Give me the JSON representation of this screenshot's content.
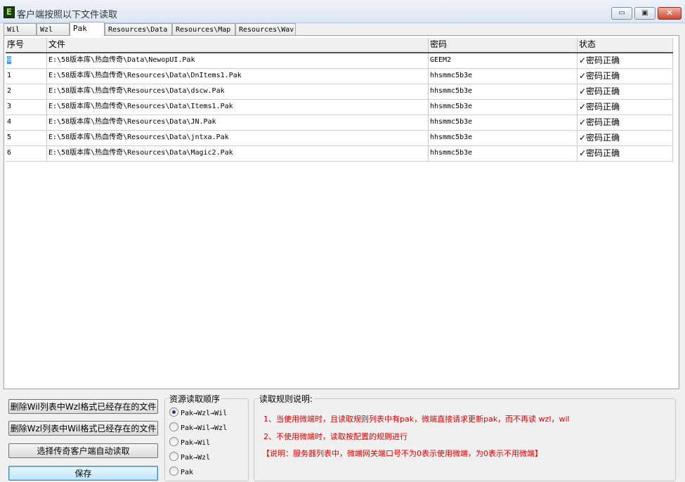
{
  "window": {
    "title": "客户端按照以下文件读取",
    "app_icon": "E",
    "controls": {
      "minimize": "▭",
      "maximize": "▣",
      "close": "✕"
    }
  },
  "tabs": [
    {
      "label": "Wil",
      "active": false
    },
    {
      "label": "Wzl",
      "active": false
    },
    {
      "label": "Pak",
      "active": true
    },
    {
      "label": "Resources\\Data",
      "active": false
    },
    {
      "label": "Resources\\Map",
      "active": false
    },
    {
      "label": "Resources\\Wav",
      "active": false
    }
  ],
  "table": {
    "columns": [
      "序号",
      "文件",
      "密码",
      "状态"
    ],
    "rows": [
      {
        "index": "0",
        "file": "E:\\58版本库\\热血传奇\\Data\\NewopUI.Pak",
        "password": "GEEM2",
        "status": "✓密码正确"
      },
      {
        "index": "1",
        "file": "E:\\58版本库\\热血传奇\\Resources\\Data\\DnItems1.Pak",
        "password": "hhsmmc5b3e",
        "status": "✓密码正确"
      },
      {
        "index": "2",
        "file": "E:\\58版本库\\热血传奇\\Resources\\Data\\dscw.Pak",
        "password": "hhsmmc5b3e",
        "status": "✓密码正确"
      },
      {
        "index": "3",
        "file": "E:\\58版本库\\热血传奇\\Resources\\Data\\Items1.Pak",
        "password": "hhsmmc5b3e",
        "status": "✓密码正确"
      },
      {
        "index": "4",
        "file": "E:\\58版本库\\热血传奇\\Resources\\Data\\JN.Pak",
        "password": "hhsmmc5b3e",
        "status": "✓密码正确"
      },
      {
        "index": "5",
        "file": "E:\\58版本库\\热血传奇\\Resources\\Data\\jntxa.Pak",
        "password": "hhsmmc5b3e",
        "status": "✓密码正确"
      },
      {
        "index": "6",
        "file": "E:\\58版本库\\热血传奇\\Resources\\Data\\Magic2.Pak",
        "password": "hhsmmc5b3e",
        "status": "✓密码正确"
      }
    ],
    "selected_row": 0
  },
  "buttons": {
    "delete_wil": "删除Wil列表中Wzl格式已经存在的文件",
    "delete_wzl": "删除Wzl列表中Wil格式已经存在的文件",
    "select_client": "选择传奇客户端自动读取",
    "save": "保存"
  },
  "read_order": {
    "title": "资源读取顺序",
    "options": [
      {
        "label": "Pak→Wzl→Wil",
        "checked": true
      },
      {
        "label": "Pak→Wil→Wzl",
        "checked": false
      },
      {
        "label": "Pak→Wil",
        "checked": false
      },
      {
        "label": "Pak→Wzl",
        "checked": false
      },
      {
        "label": "Pak",
        "checked": false
      }
    ]
  },
  "rules": {
    "title": "读取规则说明:",
    "lines": [
      "1、当使用微端时，且读取规则列表中有pak，微端直接请求更新pak，而不再读 wzl，wil",
      "2、不使用微端时，读取按配置的规则进行",
      "【说明：服务器列表中，微端网关端口号不为0表示使用微端，为0表示不用微端】"
    ],
    "color": "#e00000"
  }
}
